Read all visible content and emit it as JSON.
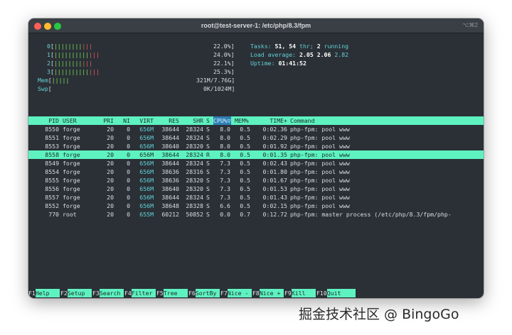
{
  "window": {
    "title": "root@test-server-1: /etc/php/8.3/fpm",
    "shortcut": "⌥⌘2"
  },
  "meters": {
    "cpus": [
      {
        "label": "0",
        "green": "||||||||",
        "red": "|||",
        "percent": "22.0%"
      },
      {
        "label": "1",
        "green": "||||||||||",
        "red": "|||",
        "percent": "24.0%"
      },
      {
        "label": "2",
        "green": "||||||||",
        "red": "|||",
        "percent": "22.1%"
      },
      {
        "label": "3",
        "green": "||||||||||",
        "red": "|||",
        "percent": "25.3%"
      }
    ],
    "mem": {
      "label": "Mem",
      "green": "|||||",
      "red": "",
      "value": "321M/7.76G"
    },
    "swp": {
      "label": "Swp",
      "green": "",
      "red": "",
      "value": "0K/1024M"
    }
  },
  "summary": {
    "tasks_label": "Tasks:",
    "tasks": "51,",
    "thr": "54",
    "thr_label": "thr;",
    "running": "2",
    "running_label": "running",
    "load_label": "Load average:",
    "load1": "2.05",
    "load5": "2.06",
    "load15": "2.82",
    "uptime_label": "Uptime:",
    "uptime": "01:41:52"
  },
  "columns": [
    "PID",
    "USER",
    "PRI",
    "NI",
    "VIRT",
    "RES",
    "SHR",
    "S",
    "CPU%▽",
    "MEM%",
    "TIME+",
    "Command"
  ],
  "processes": [
    {
      "pid": "8550",
      "user": "forge",
      "pri": "20",
      "ni": "0",
      "virt": "656M",
      "res": "38644",
      "shr": "28324",
      "s": "S",
      "cpu": "8.0",
      "mem": "0.5",
      "time": "0:02.36",
      "cmd": "php-fpm: pool www",
      "selected": false
    },
    {
      "pid": "8551",
      "user": "forge",
      "pri": "20",
      "ni": "0",
      "virt": "656M",
      "res": "38644",
      "shr": "28324",
      "s": "S",
      "cpu": "8.0",
      "mem": "0.5",
      "time": "0:02.29",
      "cmd": "php-fpm: pool www",
      "selected": false
    },
    {
      "pid": "8553",
      "user": "forge",
      "pri": "20",
      "ni": "0",
      "virt": "656M",
      "res": "38640",
      "shr": "28320",
      "s": "S",
      "cpu": "8.0",
      "mem": "0.5",
      "time": "0:01.92",
      "cmd": "php-fpm: pool www",
      "selected": false
    },
    {
      "pid": "8558",
      "user": "forge",
      "pri": "20",
      "ni": "0",
      "virt": "656M",
      "res": "38644",
      "shr": "28324",
      "s": "R",
      "cpu": "8.0",
      "mem": "0.5",
      "time": "0:01.35",
      "cmd": "php-fpm: pool www",
      "selected": true
    },
    {
      "pid": "8549",
      "user": "forge",
      "pri": "20",
      "ni": "0",
      "virt": "656M",
      "res": "38644",
      "shr": "28324",
      "s": "S",
      "cpu": "7.3",
      "mem": "0.5",
      "time": "0:02.43",
      "cmd": "php-fpm: pool www",
      "selected": false
    },
    {
      "pid": "8554",
      "user": "forge",
      "pri": "20",
      "ni": "0",
      "virt": "656M",
      "res": "38636",
      "shr": "28316",
      "s": "S",
      "cpu": "7.3",
      "mem": "0.5",
      "time": "0:01.80",
      "cmd": "php-fpm: pool www",
      "selected": false
    },
    {
      "pid": "8555",
      "user": "forge",
      "pri": "20",
      "ni": "0",
      "virt": "656M",
      "res": "38636",
      "shr": "28320",
      "s": "S",
      "cpu": "7.3",
      "mem": "0.5",
      "time": "0:01.67",
      "cmd": "php-fpm: pool www",
      "selected": false
    },
    {
      "pid": "8556",
      "user": "forge",
      "pri": "20",
      "ni": "0",
      "virt": "656M",
      "res": "38640",
      "shr": "28320",
      "s": "S",
      "cpu": "7.3",
      "mem": "0.5",
      "time": "0:01.53",
      "cmd": "php-fpm: pool www",
      "selected": false
    },
    {
      "pid": "8557",
      "user": "forge",
      "pri": "20",
      "ni": "0",
      "virt": "656M",
      "res": "38644",
      "shr": "28324",
      "s": "S",
      "cpu": "7.3",
      "mem": "0.5",
      "time": "0:01.43",
      "cmd": "php-fpm: pool www",
      "selected": false
    },
    {
      "pid": "8552",
      "user": "forge",
      "pri": "20",
      "ni": "0",
      "virt": "656M",
      "res": "38648",
      "shr": "28328",
      "s": "S",
      "cpu": "6.6",
      "mem": "0.5",
      "time": "0:02.15",
      "cmd": "php-fpm: pool www",
      "selected": false
    },
    {
      "pid": "770",
      "user": "root",
      "pri": "20",
      "ni": "0",
      "virt": "655M",
      "res": "60212",
      "shr": "50852",
      "s": "S",
      "cpu": "0.0",
      "mem": "0.7",
      "time": "0:12.72",
      "cmd": "php-fpm: master process (/etc/php/8.3/fpm/php-",
      "selected": false
    }
  ],
  "function_keys": [
    {
      "key": "F1",
      "label": "Help"
    },
    {
      "key": "F2",
      "label": "Setup"
    },
    {
      "key": "F3",
      "label": "Search"
    },
    {
      "key": "F4",
      "label": "Filter"
    },
    {
      "key": "F5",
      "label": "Tree"
    },
    {
      "key": "F6",
      "label": "SortBy"
    },
    {
      "key": "F7",
      "label": "Nice -"
    },
    {
      "key": "F8",
      "label": "Nice +"
    },
    {
      "key": "F9",
      "label": "Kill"
    },
    {
      "key": "F10",
      "label": "Quit"
    }
  ],
  "watermark": "掘金技术社区 @ BingoGo",
  "colors": {
    "terminal_bg": "#2a3036",
    "header_bg": "#5ef2c0",
    "meter_green": "#7ee15a",
    "meter_red": "#f05a5a",
    "accent_cyan": "#63d0d6"
  }
}
